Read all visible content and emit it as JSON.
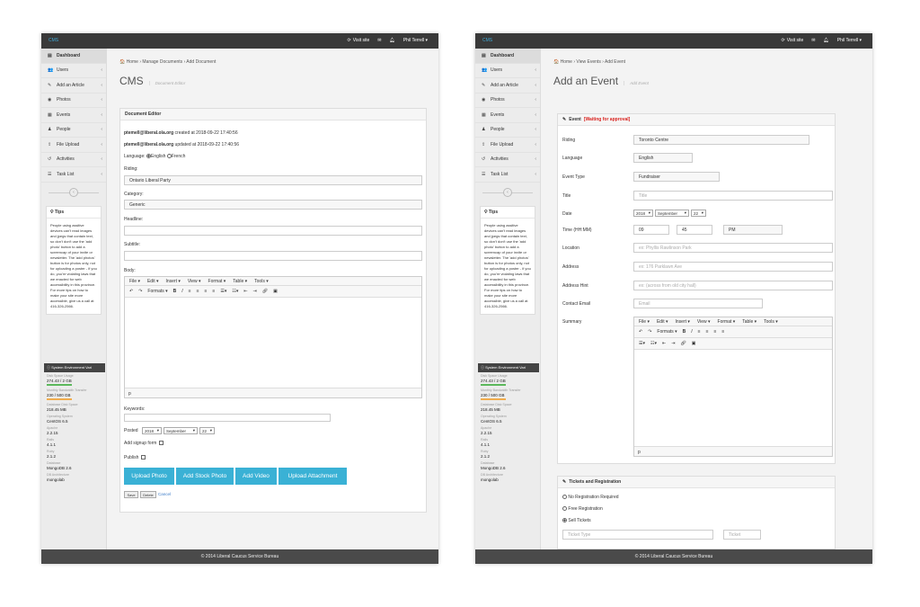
{
  "common": {
    "logo": "CMS",
    "visit_site": "Visit site",
    "user_name": "Phil Terrell ▾",
    "footer": "© 2014 Liberal Caucus Service Bureau",
    "nav": [
      {
        "icon": "dashboard-icon",
        "glyph": "▤",
        "label": "Dashboard",
        "chevron": ""
      },
      {
        "icon": "users-icon",
        "glyph": "👥",
        "label": "Users",
        "chevron": "‹"
      },
      {
        "icon": "edit-icon",
        "glyph": "✎",
        "label": "Add an Article",
        "chevron": "‹"
      },
      {
        "icon": "camera-icon",
        "glyph": "◉",
        "label": "Photos",
        "chevron": "‹"
      },
      {
        "icon": "calendar-icon",
        "glyph": "▦",
        "label": "Events",
        "chevron": "‹"
      },
      {
        "icon": "person-icon",
        "glyph": "♟",
        "label": "People",
        "chevron": "‹"
      },
      {
        "icon": "upload-icon",
        "glyph": "⇪",
        "label": "File Upload",
        "chevron": "‹"
      },
      {
        "icon": "history-icon",
        "glyph": "↺",
        "label": "Activities",
        "chevron": "‹"
      },
      {
        "icon": "list-icon",
        "glyph": "☰",
        "label": "Task List",
        "chevron": "‹"
      }
    ],
    "tips_title": "Tips",
    "tips_body": "People using assitive devices can't read images and jpegs that contain text, so don't don't use the 'add photo' button to add a screencap of your invite or newsletter. The 'add photos' button is for photos only, not for uploading a poster - if you do, you're violating laws that we enacted for web accessibility in this province. For more tips on how to make your site more accessible, give us a call at 416-326-2566.",
    "sysenv_title": "System Environment Vari",
    "sysenv": [
      {
        "label": "Disk Space Usage",
        "value": "274.43 / 2 GB",
        "bar_color": "#5cb85c"
      },
      {
        "label": "Monthly Bandwidth Transfer",
        "value": "230 / 500 GB",
        "bar_color": "#f0ad4e"
      },
      {
        "label": "Database Disk Space",
        "value": "218.45 MB",
        "bar_color": ""
      },
      {
        "label": "Operating System",
        "value": "CentOS 6.5",
        "bar_color": ""
      },
      {
        "label": "Apache",
        "value": "2.2.15",
        "bar_color": ""
      },
      {
        "label": "Rails",
        "value": "4.1.1",
        "bar_color": ""
      },
      {
        "label": "Ruby",
        "value": "2.1.2",
        "bar_color": ""
      },
      {
        "label": "Database",
        "value": "MongoDB 2.6",
        "bar_color": ""
      },
      {
        "label": "DB Architecture",
        "value": "mongolab",
        "bar_color": ""
      }
    ],
    "editor_menu": [
      "File ▾",
      "Edit ▾",
      "Insert ▾",
      "View ▾",
      "Format ▾",
      "Table ▾",
      "Tools ▾"
    ],
    "editor_status": "p"
  },
  "doc": {
    "breadcrumb": "🏠 Home  ›  Manage Documents  ›  Add Document",
    "title": "CMS",
    "subtitle": "Document Editor",
    "panel_title": "Document Editor",
    "created_line_user": "ptemell@liberal.ola.org",
    "created_line_rest": " created at 2018-09-22 17:40:56",
    "updated_line_user": "ptemell@liberal.ola.org",
    "updated_line_rest": " updated at 2018-09-22 17:40:56",
    "language_label": "Language:",
    "lang_english": "English",
    "lang_french": "French",
    "riding_label": "Riding:",
    "riding_value": "Ontario Liberal Party",
    "category_label": "Category:",
    "category_value": "Generic",
    "headline_label": "Headline:",
    "subtitle_label": "Subtitle:",
    "body_label": "Body:",
    "keywords_label": "Keywords:",
    "posted_label": "Posted",
    "posted_year": "2018",
    "posted_month": "September",
    "posted_day": "22",
    "signup_label": "Add signup form",
    "publish_label": "Publish",
    "btn_upload_photo": "Upload Photo",
    "btn_stock_photo": "Add Stock Photo",
    "btn_video": "Add Video",
    "btn_attachment": "Upload Attachment",
    "btn_save": "Save",
    "btn_delete": "Delete",
    "cancel_link": "Cancel"
  },
  "event": {
    "breadcrumb": "🏠 Home  ›  View Events  ›  Add Event",
    "title": "Add an Event",
    "subtitle": "Add Event",
    "panel_title": "Event",
    "panel_status": "[Waiting for approval]",
    "riding_label": "Riding",
    "riding_value": "Toronto Centre",
    "language_label": "Language",
    "language_value": "English",
    "type_label": "Event Type",
    "type_value": "Fundraiser",
    "title_label": "Title",
    "title_placeholder": "Title",
    "date_label": "Date",
    "date_year": "2018",
    "date_month": "September",
    "date_day": "22",
    "time_label": "Time (HH:MM)",
    "time_h": "09",
    "time_m": "45",
    "time_ampm": "PM",
    "location_label": "Location",
    "location_placeholder": "ex: Phyllis Rawlinson Park",
    "address_label": "Address",
    "address_placeholder": "ex: 176 Parklawn Ave",
    "hint_label": "Address Hint",
    "hint_placeholder": "ex: (across from old city hall)",
    "email_label": "Contact Email",
    "email_placeholder": "Email",
    "summary_label": "Summary",
    "tickets_title": "Tickets and Registration",
    "reg_none": "No Registration Required",
    "reg_free": "Free Registration",
    "reg_sell": "Sell Tickets",
    "ticket_type_placeholder": "Ticket Type",
    "ticket_placeholder": "Ticket"
  }
}
